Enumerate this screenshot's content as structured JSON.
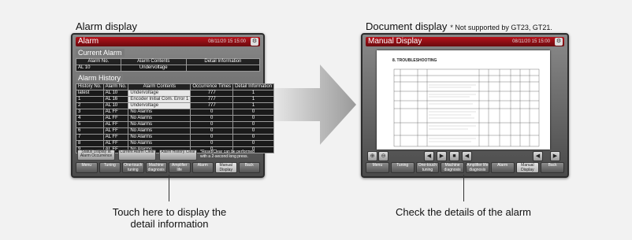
{
  "captions": {
    "left": "Alarm display",
    "right": "Document display",
    "right_note": "* Not supported by GT23, GT21.",
    "bottom_left_line1": "Touch here to display the",
    "bottom_left_line2": "detail information",
    "bottom_right": "Check the details of the alarm"
  },
  "alarm_screen": {
    "title": "Alarm",
    "clock": "08/11/20 15 15:00",
    "current_alarm_label": "Current Alarm",
    "current_headers": [
      "Alarm No.",
      "Alarm Contents",
      "Detail Information"
    ],
    "current_row": [
      "AL 10",
      "Undervoltage",
      ""
    ],
    "history_label": "Alarm History",
    "history_headers": [
      "History No.",
      "Alarm No.",
      "Alarm Contents",
      "Occurrence Times",
      "Detail Information"
    ],
    "history_rows": [
      [
        "latest",
        "AL 10",
        "Undervoltage",
        "777",
        "1"
      ],
      [
        "1",
        "AL 16",
        "Encoder Initial Com. Error 1",
        "777",
        "1"
      ],
      [
        "2",
        "AL 10",
        "Undervoltage",
        "777",
        "1"
      ],
      [
        "3",
        "AL FF",
        "No Alarms",
        "0",
        "0"
      ],
      [
        "4",
        "AL FF",
        "No Alarms",
        "0",
        "0"
      ],
      [
        "5",
        "AL FF",
        "No Alarms",
        "0",
        "0"
      ],
      [
        "6",
        "AL FF",
        "No Alarms",
        "0",
        "0"
      ],
      [
        "7",
        "AL FF",
        "No Alarms",
        "0",
        "0"
      ],
      [
        "8",
        "AL FF",
        "No Alarms",
        "0",
        "0"
      ],
      [
        "9",
        "AL FF",
        "No Alarms",
        "0",
        "0"
      ]
    ],
    "action_buttons": [
      "Status Display at Alarm Occurrence",
      "Current Alarm Clear",
      "Alarm History Clear"
    ],
    "reset_note": "*Reset/Clear can be performed with a 2-second long press.",
    "bottom_buttons": [
      "Menu",
      "Tuning",
      "One-touch tuning",
      "Machine diagnosis",
      "Amplifier life diagnosis",
      "Alarm",
      "Manual Display",
      "Back"
    ],
    "active_bottom_index": 6
  },
  "document_screen": {
    "title": "Manual Display",
    "clock": "08/11/20 15 15:00",
    "doc_heading": "8. TROUBLESHOOTING",
    "bottom_buttons": [
      "Menu",
      "Tuning",
      "One-touch tuning",
      "Machine diagnosis",
      "Amplifier life diagnosis",
      "Alarm",
      "Manual Display",
      "Back"
    ],
    "active_bottom_index": 6,
    "nav_icons": [
      "first-page-icon",
      "prev-page-icon",
      "next-page-icon",
      "last-page-icon"
    ],
    "zoom_icons": [
      "zoom-in-icon",
      "zoom-out-icon"
    ]
  },
  "colors": {
    "title_red": "#b6121b",
    "arrow": "#b0b0b0",
    "background": "#f2f2f2"
  }
}
